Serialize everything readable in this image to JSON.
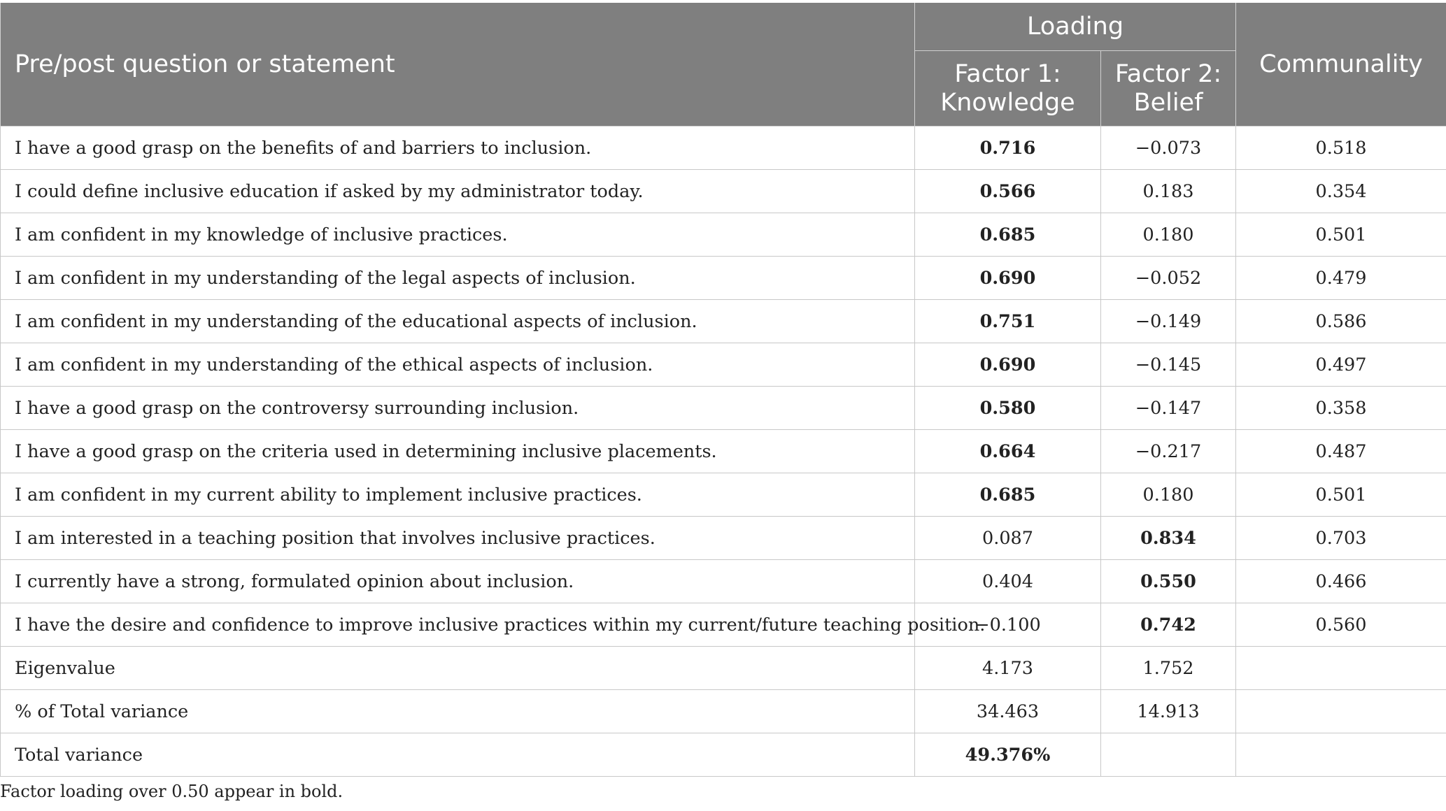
{
  "header": {
    "statement": "Pre/post question or statement",
    "loading": "Loading",
    "factor1_line1": "Factor 1:",
    "factor1_line2": "Knowledge",
    "factor2_line1": "Factor 2:",
    "factor2_line2": "Belief",
    "communality": "Communality"
  },
  "rows": [
    {
      "statement": "I have a good grasp on the benefits of and barriers to inclusion.",
      "f1": "0.716",
      "f2": "−0.073",
      "comm": "0.518",
      "bold": "f1"
    },
    {
      "statement": "I could define inclusive education if asked by my administrator today.",
      "f1": "0.566",
      "f2": "0.183",
      "comm": "0.354",
      "bold": "f1"
    },
    {
      "statement": "I am confident in my knowledge of inclusive practices.",
      "f1": "0.685",
      "f2": "0.180",
      "comm": "0.501",
      "bold": "f1"
    },
    {
      "statement": "I am confident in my understanding of the legal aspects of inclusion.",
      "f1": "0.690",
      "f2": "−0.052",
      "comm": "0.479",
      "bold": "f1"
    },
    {
      "statement": "I am confident in my understanding of the educational aspects of inclusion.",
      "f1": "0.751",
      "f2": "−0.149",
      "comm": "0.586",
      "bold": "f1"
    },
    {
      "statement": "I am confident in my understanding of the ethical aspects of inclusion.",
      "f1": "0.690",
      "f2": "−0.145",
      "comm": "0.497",
      "bold": "f1"
    },
    {
      "statement": "I have a good grasp on the controversy surrounding inclusion.",
      "f1": "0.580",
      "f2": "−0.147",
      "comm": "0.358",
      "bold": "f1"
    },
    {
      "statement": "I have a good grasp on the criteria used in determining inclusive placements.",
      "f1": "0.664",
      "f2": "−0.217",
      "comm": "0.487",
      "bold": "f1"
    },
    {
      "statement": "I am confident in my current ability to implement inclusive practices.",
      "f1": "0.685",
      "f2": "0.180",
      "comm": "0.501",
      "bold": "f1"
    },
    {
      "statement": "I am interested in a teaching position that involves inclusive practices.",
      "f1": "0.087",
      "f2": "0.834",
      "comm": "0.703",
      "bold": "f2"
    },
    {
      "statement": "I currently have a strong, formulated opinion about inclusion.",
      "f1": "0.404",
      "f2": "0.550",
      "comm": "0.466",
      "bold": "f2"
    },
    {
      "statement": "I have the desire and confidence to improve inclusive practices within my current/future teaching position.",
      "f1": "−0.100",
      "f2": "0.742",
      "comm": "0.560",
      "bold": "f2"
    },
    {
      "statement": "Eigenvalue",
      "f1": "4.173",
      "f2": "1.752",
      "comm": "",
      "bold": ""
    },
    {
      "statement": "% of Total variance",
      "f1": "34.463",
      "f2": "14.913",
      "comm": "",
      "bold": ""
    },
    {
      "statement": "Total variance",
      "f1": "49.376%",
      "f2": "",
      "comm": "",
      "bold": "f1"
    }
  ],
  "footnote": "Factor loading over 0.50 appear in bold."
}
